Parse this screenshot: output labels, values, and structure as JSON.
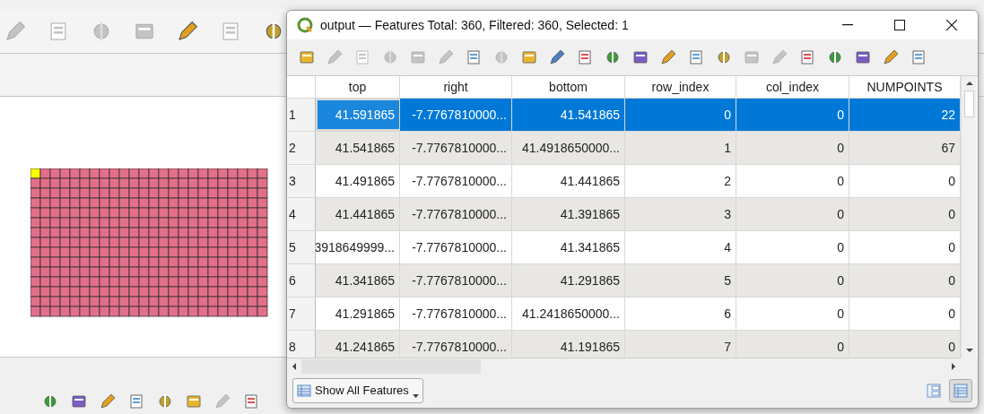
{
  "main_toolbar": [
    {
      "disabled": true
    },
    {
      "disabled": true
    },
    {
      "disabled": true
    },
    {
      "disabled": true
    },
    {
      "disabled": false
    },
    {
      "disabled": true
    },
    {
      "disabled": false
    }
  ],
  "map": {
    "kind": "grid"
  },
  "console_toolbar": [
    {
      "disabled": false
    },
    {
      "disabled": false
    },
    {
      "disabled": false
    },
    {
      "disabled": false
    },
    {
      "disabled": false
    },
    {
      "disabled": false
    },
    {
      "disabled": true
    },
    {
      "disabled": false
    }
  ],
  "dialog": {
    "title": "output — Features Total: 360, Filtered: 360, Selected: 1",
    "toolbar": [
      {
        "disabled": false
      },
      {
        "disabled": true
      },
      {
        "disabled": true
      },
      {
        "disabled": true
      },
      {
        "disabled": true
      },
      {
        "disabled": true
      },
      {
        "disabled": false
      },
      {
        "disabled": true
      },
      {
        "disabled": false
      },
      {
        "disabled": false
      },
      {
        "disabled": false
      },
      {
        "disabled": false
      },
      {
        "disabled": false
      },
      {
        "disabled": false
      },
      {
        "disabled": false
      },
      {
        "disabled": false
      },
      {
        "disabled": true
      },
      {
        "disabled": true
      },
      {
        "disabled": false
      },
      {
        "disabled": false
      },
      {
        "disabled": false
      },
      {
        "disabled": false
      },
      {
        "disabled": false
      }
    ],
    "table": {
      "columns": [
        "top",
        "right",
        "bottom",
        "row_index",
        "col_index",
        "NUMPOINTS"
      ],
      "rows": [
        {
          "header": "1",
          "selected": true,
          "current": true,
          "cells": [
            "41.591865",
            "-7.7767810000...",
            "41.541865",
            "0",
            "0",
            "22"
          ]
        },
        {
          "header": "2",
          "selected": false,
          "current": false,
          "cells": [
            "41.541865",
            "-7.7767810000...",
            "41.4918650000...",
            "1",
            "0",
            "67"
          ]
        },
        {
          "header": "3",
          "selected": false,
          "current": false,
          "cells": [
            "41.491865",
            "-7.7767810000...",
            "41.441865",
            "2",
            "0",
            "0"
          ]
        },
        {
          "header": "4",
          "selected": false,
          "current": false,
          "cells": [
            "41.441865",
            "-7.7767810000...",
            "41.391865",
            "3",
            "0",
            "0"
          ]
        },
        {
          "header": "5",
          "selected": false,
          "current": false,
          "cells": [
            "3918649999...",
            "-7.7767810000...",
            "41.341865",
            "4",
            "0",
            "0"
          ]
        },
        {
          "header": "6",
          "selected": false,
          "current": false,
          "cells": [
            "41.341865",
            "-7.7767810000...",
            "41.291865",
            "5",
            "0",
            "0"
          ]
        },
        {
          "header": "7",
          "selected": false,
          "current": false,
          "cells": [
            "41.291865",
            "-7.7767810000...",
            "41.2418650000...",
            "6",
            "0",
            "0"
          ]
        },
        {
          "header": "8",
          "selected": false,
          "current": false,
          "cells": [
            "41.241865",
            "-7.7767810000...",
            "41.191865",
            "7",
            "0",
            "0"
          ]
        }
      ]
    },
    "filter_button": "Show All Features",
    "view_buttons": [
      {
        "selected": false
      },
      {
        "selected": true
      }
    ]
  }
}
